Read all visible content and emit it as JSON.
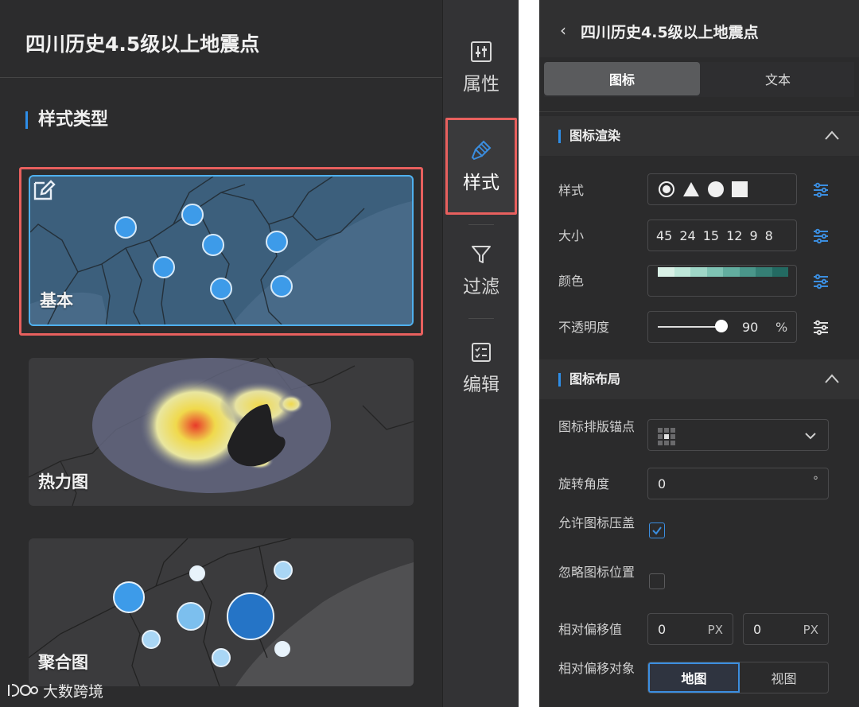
{
  "left": {
    "title": "四川历史4.5级以上地震点",
    "section_title": "样式类型",
    "cards": [
      {
        "label": "基本"
      },
      {
        "label": "热力图"
      },
      {
        "label": "聚合图"
      }
    ]
  },
  "watermark": {
    "text": "大数跨境"
  },
  "tabs": [
    {
      "label": "属性",
      "icon": "sliders-icon"
    },
    {
      "label": "样式",
      "icon": "brush-icon"
    },
    {
      "label": "过滤",
      "icon": "funnel-icon"
    },
    {
      "label": "编辑",
      "icon": "checklist-icon"
    }
  ],
  "right": {
    "title": "四川历史4.5级以上地震点",
    "tabs": [
      "图标",
      "文本"
    ],
    "render_section": {
      "title": "图标渲染",
      "style_label": "样式",
      "size_label": "大小",
      "sizes": [
        "45",
        "24",
        "15",
        "12",
        "9",
        "8"
      ],
      "color_label": "颜色",
      "color_ramp": [
        "#d9f0e6",
        "#bde6d8",
        "#9fd6c7",
        "#7fc3b4",
        "#62ad9f",
        "#4a968a",
        "#357f75",
        "#236a62"
      ],
      "opacity_label": "不透明度",
      "opacity_value": "90",
      "opacity_unit": "%"
    },
    "layout_section": {
      "title": "图标布局",
      "anchor_label": "图标排版锚点",
      "rotation_label": "旋转角度",
      "rotation_value": "0",
      "rotation_unit": "°",
      "allow_overlap_label": "允许图标压盖",
      "allow_overlap_checked": true,
      "ignore_position_label": "忽略图标位置",
      "ignore_position_checked": false,
      "offset_label": "相对偏移值",
      "offset_x": "0",
      "offset_y": "0",
      "offset_unit": "PX",
      "relative_target_label": "相对偏移对象",
      "relative_target_options": [
        "地图",
        "视图"
      ],
      "relative_target_selected": "地图"
    }
  },
  "colors": {
    "accent": "#2e8ee8",
    "highlight": "#e8605e",
    "panel_bg": "#2c2c2d"
  }
}
